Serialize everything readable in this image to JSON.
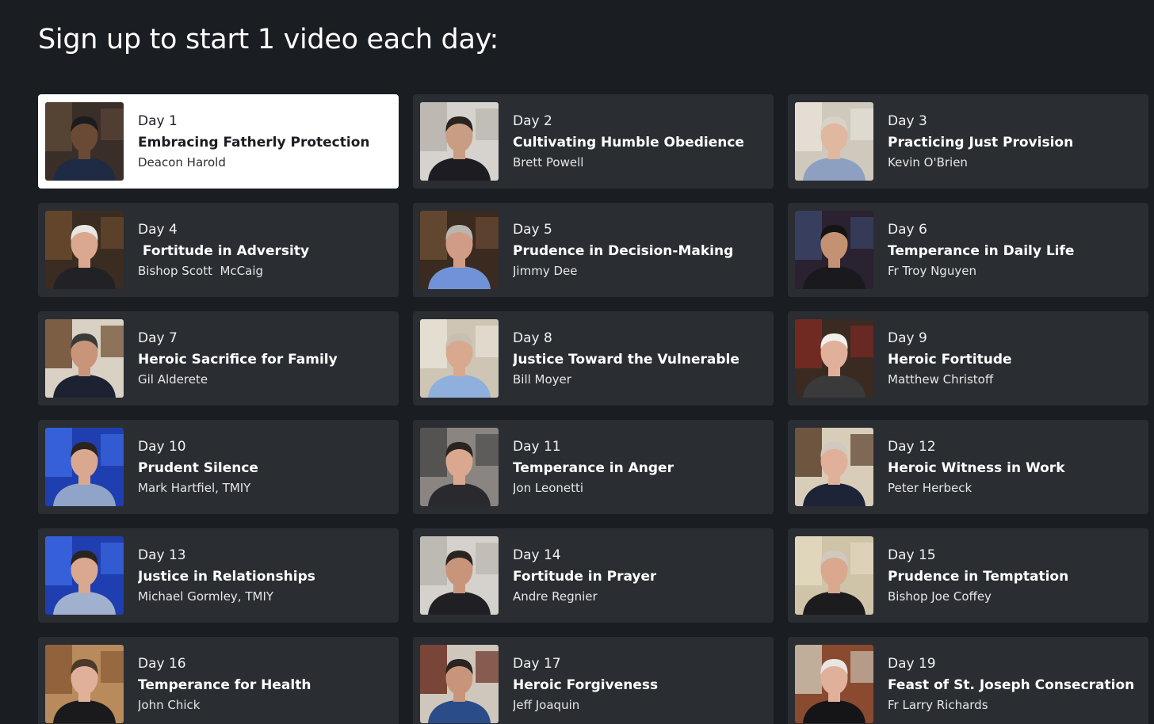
{
  "page": {
    "heading": "Sign up to start 1 video each day:"
  },
  "colors": {
    "background": "#1a1d21",
    "card": "#2a2d32",
    "card_selected": "#ffffff"
  },
  "videos": [
    {
      "day": "Day 1",
      "title": "Embracing Fatherly Protection",
      "speaker": "Deacon Harold",
      "selected": true,
      "thumb": {
        "bg": "#3a2e28",
        "accent": "#5b4636",
        "skin": "#6b4a35",
        "shirt": "#1f2a44",
        "hair": "#1c1c1c"
      }
    },
    {
      "day": "Day 2",
      "title": "Cultivating Humble Obedience",
      "speaker": "Brett Powell",
      "selected": false,
      "thumb": {
        "bg": "#d6d3cf",
        "accent": "#b8b3ad",
        "skin": "#c99d83",
        "shirt": "#1c1c22",
        "hair": "#2a2420"
      }
    },
    {
      "day": "Day 3",
      "title": "Practicing Just Provision",
      "speaker": "Kevin O'Brien",
      "selected": false,
      "thumb": {
        "bg": "#cfc8bd",
        "accent": "#e6e1d8",
        "skin": "#e0b79f",
        "shirt": "#8ea0c2",
        "hair": "#d8d2c6"
      }
    },
    {
      "day": "Day 4",
      "title": " Fortitude in Adversity",
      "speaker": "Bishop Scott  McCaig",
      "selected": false,
      "thumb": {
        "bg": "#3b2c22",
        "accent": "#6b4a2e",
        "skin": "#d9a88e",
        "shirt": "#222226",
        "hair": "#e8e6e2"
      }
    },
    {
      "day": "Day 5",
      "title": "Prudence in Decision-Making",
      "speaker": "Jimmy Dee",
      "selected": false,
      "thumb": {
        "bg": "#3a2a20",
        "accent": "#6a4c34",
        "skin": "#d19c86",
        "shirt": "#6f93d6",
        "hair": "#b9b5af"
      }
    },
    {
      "day": "Day 6",
      "title": "Temperance in Daily Life",
      "speaker": "Fr Troy Nguyen",
      "selected": false,
      "thumb": {
        "bg": "#2a2230",
        "accent": "#3b4466",
        "skin": "#c49272",
        "shirt": "#1a1a1e",
        "hair": "#141414"
      }
    },
    {
      "day": "Day 7",
      "title": "Heroic Sacrifice for Family",
      "speaker": "Gil Alderete",
      "selected": false,
      "thumb": {
        "bg": "#d9d2c4",
        "accent": "#6b4a2e",
        "skin": "#c9957a",
        "shirt": "#1d2233",
        "hair": "#3a3a3a"
      }
    },
    {
      "day": "Day 8",
      "title": "Justice Toward the Vulnerable",
      "speaker": "Bill Moyer",
      "selected": false,
      "thumb": {
        "bg": "#cfc5b5",
        "accent": "#e8e2d6",
        "skin": "#d8a98e",
        "shirt": "#8fb0dc",
        "hair": "#c8bfb2"
      }
    },
    {
      "day": "Day 9",
      "title": "Heroic Fortitude",
      "speaker": "Matthew Christoff",
      "selected": false,
      "thumb": {
        "bg": "#3a2a22",
        "accent": "#7a2a22",
        "skin": "#e0b09a",
        "shirt": "#3a3a3a",
        "hair": "#f0efec"
      }
    },
    {
      "day": "Day 10",
      "title": "Prudent Silence",
      "speaker": "Mark Hartfiel, TMIY",
      "selected": false,
      "thumb": {
        "bg": "#1f3fb0",
        "accent": "#3a66e0",
        "skin": "#d9a88e",
        "shirt": "#8fa4c8",
        "hair": "#2a2420"
      }
    },
    {
      "day": "Day 11",
      "title": "Temperance in Anger",
      "speaker": "Jon Leonetti",
      "selected": false,
      "thumb": {
        "bg": "#8a8580",
        "accent": "#4a4a4a",
        "skin": "#d9a88e",
        "shirt": "#2a2a2e",
        "hair": "#2a2420"
      }
    },
    {
      "day": "Day 12",
      "title": "Heroic Witness in Work",
      "speaker": "Peter Herbeck",
      "selected": false,
      "thumb": {
        "bg": "#d8cdb8",
        "accent": "#5b3f2a",
        "skin": "#e0b09a",
        "shirt": "#1d2438",
        "hair": "#cfc9bf"
      }
    },
    {
      "day": "Day 13",
      "title": "Justice in Relationships",
      "speaker": "Michael Gormley, TMIY",
      "selected": false,
      "thumb": {
        "bg": "#1f3fb0",
        "accent": "#3a66e0",
        "skin": "#d9a88e",
        "shirt": "#9fb1cf",
        "hair": "#2a2420"
      }
    },
    {
      "day": "Day 14",
      "title": "Fortitude in Prayer",
      "speaker": "Andre Regnier",
      "selected": false,
      "thumb": {
        "bg": "#d5d2cd",
        "accent": "#b9b5ae",
        "skin": "#c9957a",
        "shirt": "#202024",
        "hair": "#2a2420"
      }
    },
    {
      "day": "Day 15",
      "title": "Prudence in Temptation",
      "speaker": "Bishop Joe Coffey",
      "selected": false,
      "thumb": {
        "bg": "#cfc4a8",
        "accent": "#e2d9c0",
        "skin": "#d9a88e",
        "shirt": "#1c1c1e",
        "hair": "#cfc9bf"
      }
    },
    {
      "day": "Day 16",
      "title": "Temperance for Health",
      "speaker": "John Chick",
      "selected": false,
      "thumb": {
        "bg": "#b98a5c",
        "accent": "#8a5a36",
        "skin": "#e0b09a",
        "shirt": "#1a1a1c",
        "hair": "#4a3a2a"
      }
    },
    {
      "day": "Day 17",
      "title": "Heroic Forgiveness",
      "speaker": "Jeff Joaquin",
      "selected": false,
      "thumb": {
        "bg": "#cfc7bb",
        "accent": "#6a2e22",
        "skin": "#c9957a",
        "shirt": "#2a4c88",
        "hair": "#2a2420"
      }
    },
    {
      "day": "Day 19",
      "title": "Feast of St. Joseph Consecration",
      "speaker": "Fr Larry Richards",
      "selected": false,
      "thumb": {
        "bg": "#8a4a30",
        "accent": "#c9bfae",
        "skin": "#e0b09a",
        "shirt": "#151517",
        "hair": "#e8e6e2"
      }
    }
  ]
}
